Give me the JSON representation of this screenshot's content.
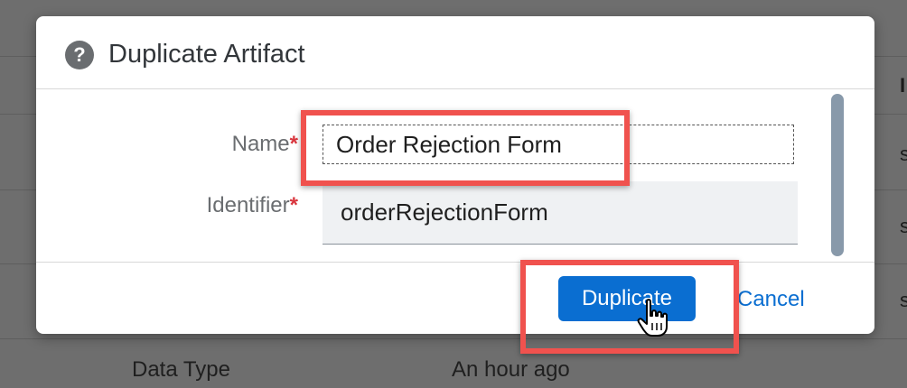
{
  "dialog": {
    "title": "Duplicate Artifact",
    "fields": {
      "name": {
        "label": "Name",
        "value": "Order Rejection Form"
      },
      "identifier": {
        "label": "Identifier",
        "value": "orderRejectionForm"
      }
    },
    "required_marker": "*",
    "buttons": {
      "duplicate": "Duplicate",
      "cancel": "Cancel"
    }
  },
  "background_page": {
    "visible_letters": [
      "I",
      "s",
      "s",
      "s"
    ],
    "row": {
      "type": "Data Type",
      "modified": "An hour ago"
    }
  },
  "colors": {
    "primary": "#0a6ed1",
    "required": "#d9363e",
    "highlight": "#f0524e",
    "overlay": "#6e6e6e"
  },
  "icons": [
    "help-icon",
    "hand-pointer-cursor-icon"
  ]
}
